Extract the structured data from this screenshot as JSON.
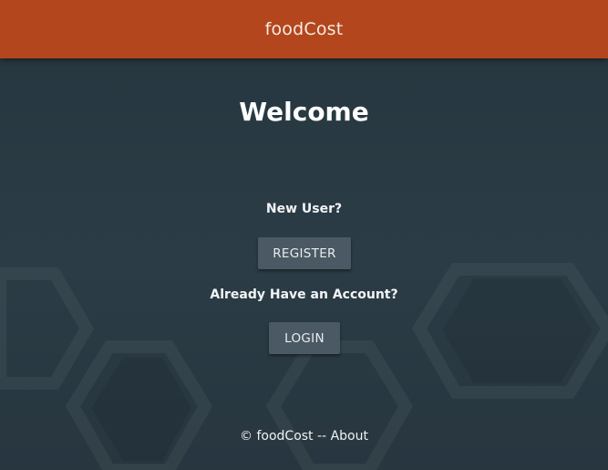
{
  "header": {
    "app_title": "foodCost"
  },
  "main": {
    "welcome_heading": "Welcome",
    "new_user_prompt": "New User?",
    "register_label": "REGISTER",
    "existing_user_prompt": "Already Have an Account?",
    "login_label": "LOGIN"
  },
  "footer": {
    "copyright": "© foodCost",
    "separator": "--",
    "about_label": "About"
  },
  "colors": {
    "header_bg": "#b3461d",
    "page_bg": "#263640",
    "button_bg": "#4a5963"
  }
}
